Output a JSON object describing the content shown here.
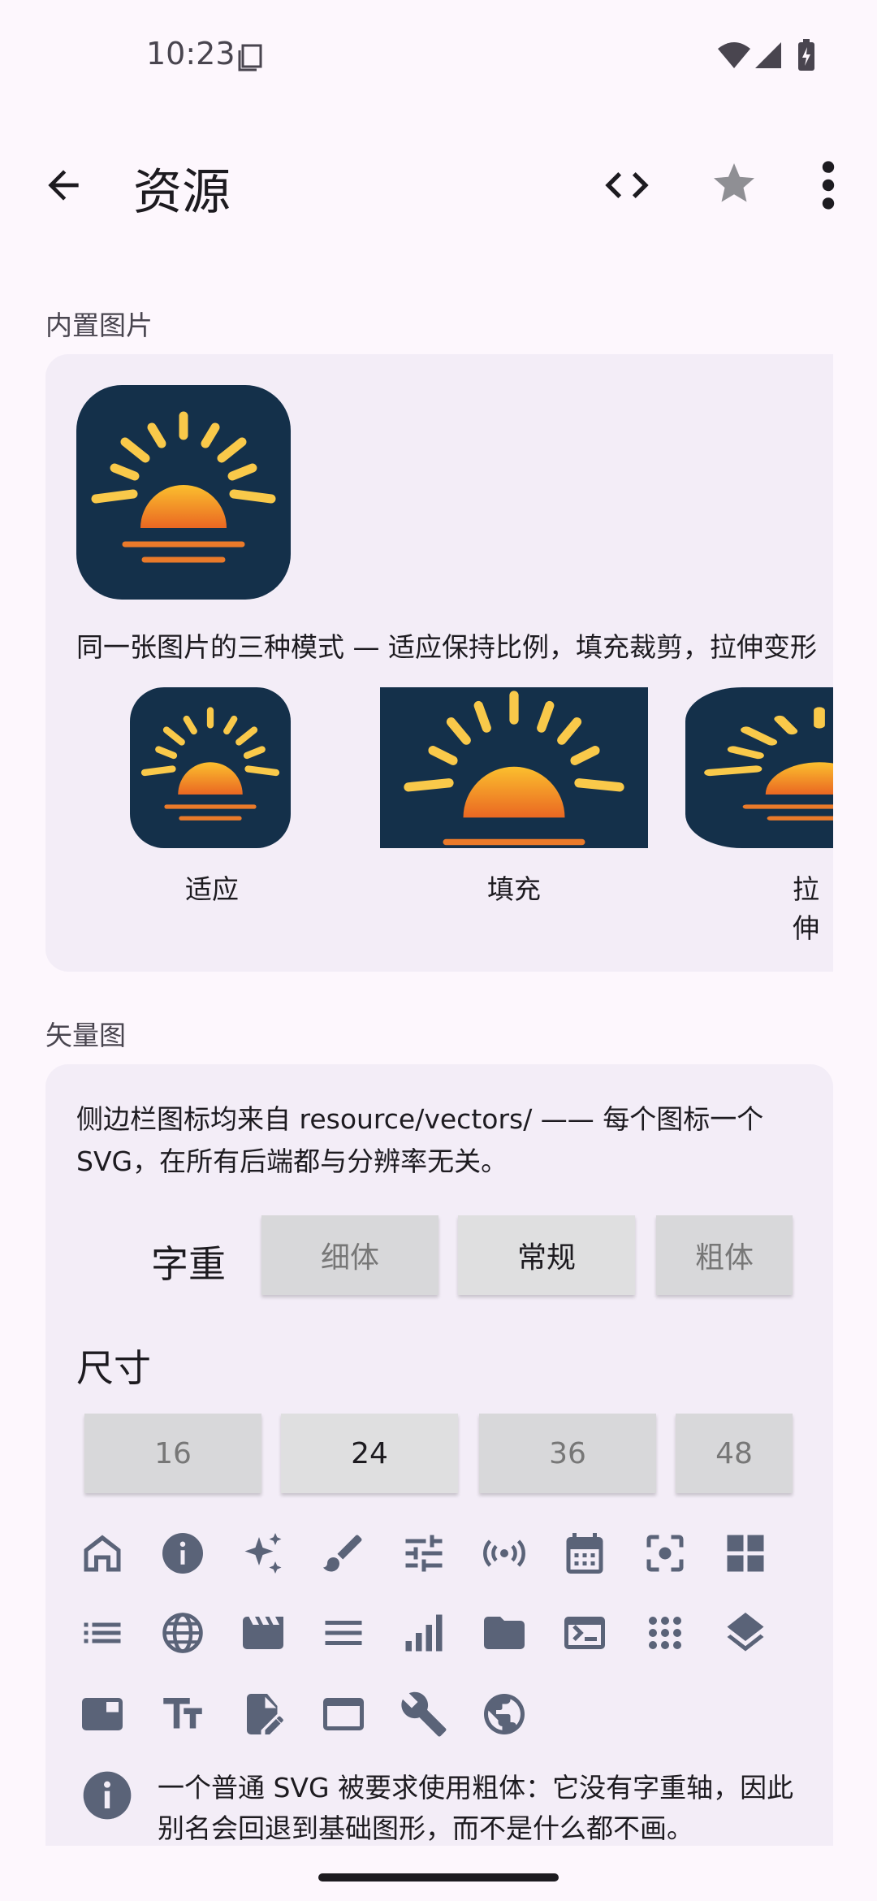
{
  "status_bar": {
    "time": "10:23"
  },
  "app_bar": {
    "title": "资源"
  },
  "builtin": {
    "section_label": "内置图片",
    "caption": "同一张图片的三种模式 — 适应保持比例，填充裁剪，拉伸变形",
    "modes": [
      "适应",
      "填充",
      "拉伸"
    ]
  },
  "vectors": {
    "section_label": "矢量图",
    "description": "侧边栏图标均来自 resource/vectors/ —— 每个图标一个 SVG，在所有后端都与分辨率无关。",
    "weight_label": "字重",
    "weights": [
      "细体",
      "常规",
      "粗体"
    ],
    "selected_weight": "常规",
    "size_label": "尺寸",
    "sizes": [
      "16",
      "24",
      "36",
      "48"
    ],
    "selected_size": "24",
    "icons": [
      "home-icon",
      "info-icon",
      "sparkles-icon",
      "brush-icon",
      "tune-icon",
      "broadcast-icon",
      "calendar-icon",
      "center-focus-icon",
      "dashboard-icon",
      "list-icon",
      "globe-icon",
      "movie-icon",
      "menu-icon",
      "signal-bars-icon",
      "folder-icon",
      "terminal-icon",
      "apps-grid-icon",
      "layers-icon",
      "window-panel-icon",
      "text-size-icon",
      "edit-document-icon",
      "browser-window-icon",
      "wrench-icon",
      "public-icon"
    ],
    "note": "一个普通 SVG 被要求使用粗体：它没有字重轴，因此别名会回退到基础图形，而不是什么都不画。"
  },
  "colors": {
    "background": "#fdf7fd",
    "card": "#f3edf7",
    "icon": "#5a6378",
    "sun_bg": "#14304a"
  }
}
